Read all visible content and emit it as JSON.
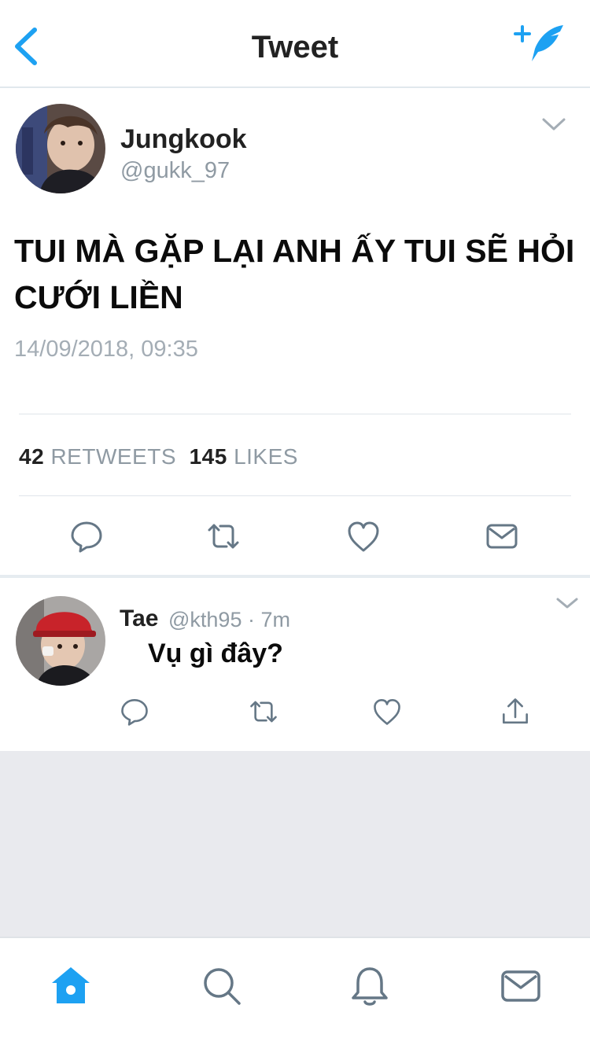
{
  "header": {
    "title": "Tweet",
    "back_icon": "chevron-left-icon",
    "compose_icon": "compose-tweet-icon",
    "accent": "#1da1f2"
  },
  "tweet": {
    "author_name": "Jungkook",
    "author_handle": "@gukk_97",
    "text_line1": "TUI MÀ GẶP LẠI ANH ẤY TUI SẼ HỎI",
    "text_line2": "CƯỚI LIỀN",
    "timestamp": "14/09/2018, 09:35",
    "retweets_count": "42",
    "retweets_label": "RETWEETS",
    "likes_count": "145",
    "likes_label": "LIKES",
    "actions": [
      "reply-icon",
      "retweet-icon",
      "like-icon",
      "message-icon"
    ]
  },
  "reply": {
    "author_name": "Tae",
    "meta": "@kth95 · 7m",
    "text": "Vụ gì đây?",
    "actions": [
      "reply-icon",
      "retweet-icon",
      "like-icon",
      "share-icon"
    ]
  },
  "tabbar": {
    "items": [
      "home-icon",
      "search-icon",
      "notifications-icon",
      "messages-icon"
    ],
    "active_color": "#1da1f2",
    "inactive_color": "#657786"
  }
}
